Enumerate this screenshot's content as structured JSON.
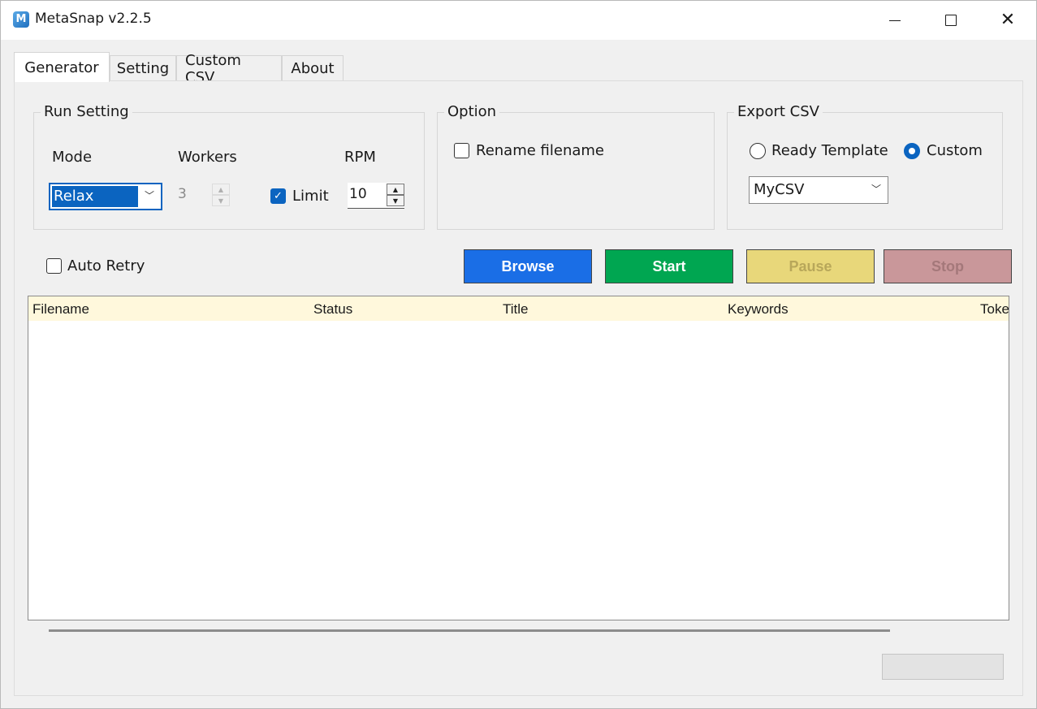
{
  "window": {
    "title": "MetaSnap v2.2.5",
    "icon_letter": "M"
  },
  "tabs": [
    {
      "label": "Generator"
    },
    {
      "label": "Setting"
    },
    {
      "label": "Custom CSV"
    },
    {
      "label": "About"
    }
  ],
  "run_setting": {
    "title": "Run Setting",
    "mode_label": "Mode",
    "mode_value": "Relax",
    "workers_label": "Workers",
    "workers_value": "3",
    "limit_label": "Limit",
    "limit_checked": true,
    "rpm_label": "RPM",
    "rpm_value": "10"
  },
  "option": {
    "title": "Option",
    "rename_label": "Rename filename",
    "rename_checked": false
  },
  "export_csv": {
    "title": "Export CSV",
    "ready_label": "Ready Template",
    "custom_label": "Custom",
    "selected": "Custom",
    "combo_value": "MyCSV"
  },
  "auto_retry": {
    "label": "Auto Retry",
    "checked": false
  },
  "actions": {
    "browse": "Browse",
    "start": "Start",
    "pause": "Pause",
    "stop": "Stop"
  },
  "table": {
    "columns": [
      "Filename",
      "Status",
      "Title",
      "Keywords",
      "Toke"
    ]
  },
  "colors": {
    "accent": "#0b64c0",
    "browse": "#1a6ee6",
    "start": "#00a651",
    "pause": "#e8d77a",
    "stop": "#c9979a",
    "table_header": "#fff8dc"
  }
}
